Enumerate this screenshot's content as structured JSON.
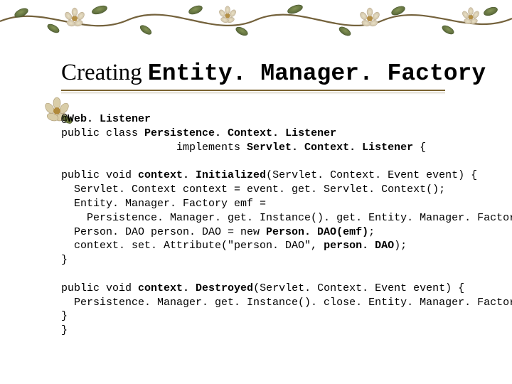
{
  "title": {
    "serif": "Creating ",
    "mono": "Entity. Manager. Factory"
  },
  "code": {
    "l1": "@Web. Listener",
    "l2a": "public class ",
    "l2b": "Persistence. Context. Listener",
    "l3a": "                  implements ",
    "l3b": "Servlet. Context. Listener",
    "l3c": " {",
    "blank1": "",
    "l4a": "public void ",
    "l4b": "context. Initialized",
    "l4c": "(Servlet. Context. Event event) {",
    "l5": "  Servlet. Context context = event. get. Servlet. Context();",
    "l6": "  Entity. Manager. Factory emf =",
    "l7": "    Persistence. Manager. get. Instance(). get. Entity. Manager. Factory();",
    "l8a": "  Person. DAO person. DAO = new ",
    "l8b": "Person. DAO(emf)",
    "l8c": ";",
    "l9a": "  context. set. Attribute(\"person. DAO\", ",
    "l9b": "person. DAO",
    "l9c": ");",
    "l10": "}",
    "blank2": "",
    "l11a": "public void ",
    "l11b": "context. Destroyed",
    "l11c": "(Servlet. Context. Event event) {",
    "l12": "  Persistence. Manager. get. Instance(). close. Entity. Manager. Factory();",
    "l13": "}",
    "l14": "}"
  }
}
